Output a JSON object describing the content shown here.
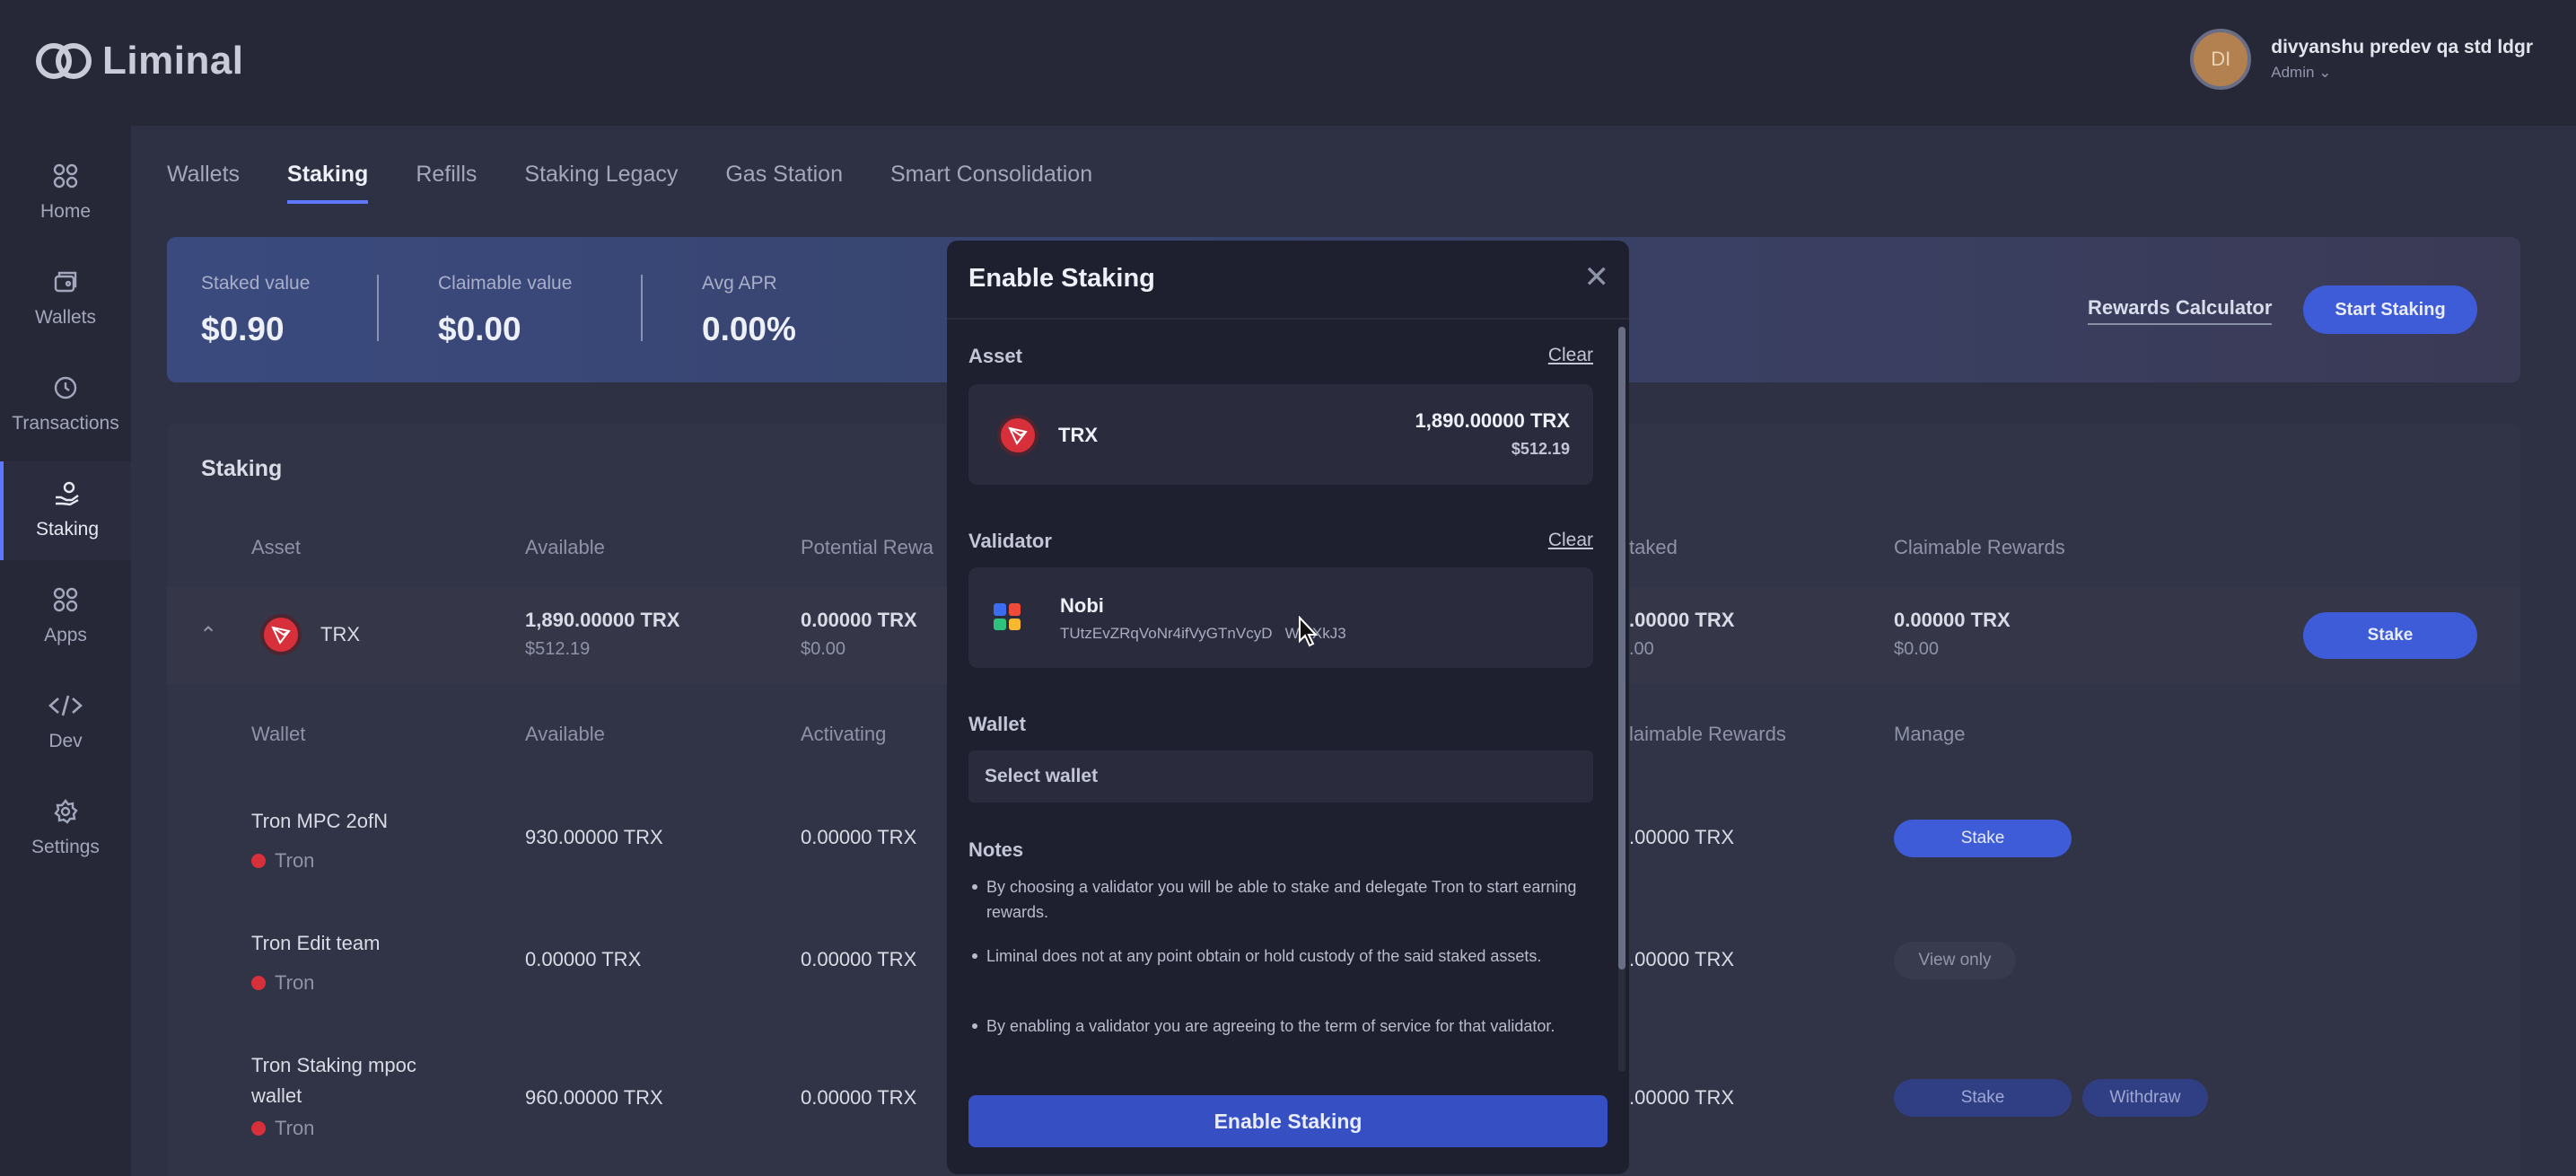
{
  "brand": {
    "name": "Liminal"
  },
  "user": {
    "initials": "DI",
    "name": "divyanshu predev qa std ldgr",
    "role": "Admin"
  },
  "sidebar": {
    "items": [
      {
        "label": "Home",
        "icon": "grid-icon"
      },
      {
        "label": "Wallets",
        "icon": "wallet-icon"
      },
      {
        "label": "Transactions",
        "icon": "clock-icon"
      },
      {
        "label": "Staking",
        "icon": "staking-hand-icon"
      },
      {
        "label": "Apps",
        "icon": "apps-icon"
      },
      {
        "label": "Dev",
        "icon": "code-icon"
      },
      {
        "label": "Settings",
        "icon": "gear-icon"
      }
    ],
    "active": "Staking"
  },
  "tabs": [
    "Wallets",
    "Staking",
    "Refills",
    "Staking Legacy",
    "Gas Station",
    "Smart Consolidation"
  ],
  "summary": {
    "staked_label": "Staked value",
    "staked_value": "$0.90",
    "claimable_label": "Claimable value",
    "claimable_value": "$0.00",
    "apr_label": "Avg APR",
    "apr_value": "0.00%",
    "rewards_calculator": "Rewards Calculator",
    "start_staking": "Start Staking"
  },
  "staking_table": {
    "title": "Staking",
    "headers": {
      "asset": "Asset",
      "available": "Available",
      "potential": "Potential Rewa",
      "staked": "taked",
      "claimable": "Claimable Rewards"
    },
    "asset_row": {
      "asset": "TRX",
      "available": "1,890.00000 TRX",
      "available_usd": "$512.19",
      "potential": "0.00000 TRX",
      "potential_usd": "$0.00",
      "staked": ".00000 TRX",
      "staked_usd": ".00",
      "claimable": "0.00000 TRX",
      "claimable_usd": "$0.00",
      "stake_button": "Stake"
    },
    "wallet_headers": {
      "wallet": "Wallet",
      "available": "Available",
      "activating": "Activating",
      "claimable": "laimable Rewards",
      "manage": "Manage"
    },
    "wallets": [
      {
        "name": "Tron MPC 2ofN",
        "network": "Tron",
        "available": "930.00000 TRX",
        "activating": "0.00000 TRX",
        "claimable": ".00000 TRX",
        "actions": [
          "Stake"
        ]
      },
      {
        "name": "Tron Edit team",
        "network": "Tron",
        "available": "0.00000 TRX",
        "activating": "0.00000 TRX",
        "claimable": ".00000 TRX",
        "actions": [
          "View only"
        ]
      },
      {
        "name": "Tron Staking mpoc wallet",
        "network": "Tron",
        "available": "960.00000 TRX",
        "activating": "0.00000 TRX",
        "claimable": ".00000 TRX",
        "actions": [
          "Stake",
          "Withdraw"
        ]
      }
    ]
  },
  "modal": {
    "title": "Enable Staking",
    "asset_label": "Asset",
    "clear": "Clear",
    "asset": {
      "name": "TRX",
      "amount": "1,890.00000 TRX",
      "usd": "$512.19"
    },
    "validator_label": "Validator",
    "validator": {
      "name": "Nobi",
      "address": "TUtzEvZRqVoNr4ifVyGTnVcyD   WsrXkJ3"
    },
    "wallet_label": "Wallet",
    "wallet_placeholder": "Select wallet",
    "notes_label": "Notes",
    "notes": [
      "By choosing a validator you will be able to stake and delegate Tron to start earning rewards.",
      "Liminal does not at any point obtain or hold custody of the said staked assets.",
      "By enabling a validator you are agreeing to the term of service for that validator."
    ],
    "enable_button": "Enable Staking"
  },
  "colors": {
    "accent": "#3e5bd8",
    "tron_red": "#d8303a",
    "background": "#2e3043",
    "modal": "#1e2030"
  }
}
